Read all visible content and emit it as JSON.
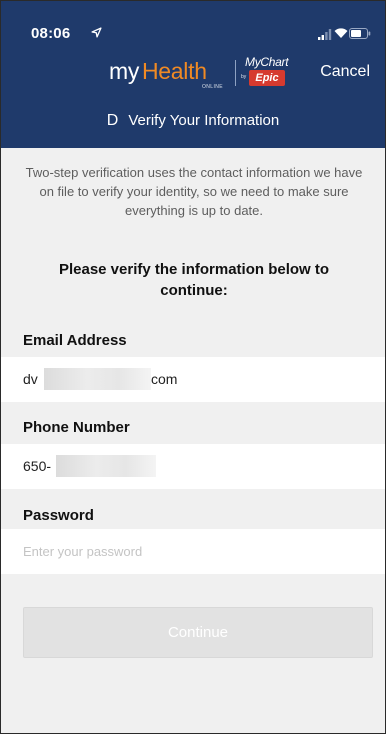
{
  "status_bar": {
    "time": "08:06"
  },
  "brand": {
    "my": "my",
    "health": "Health",
    "online": "ONLINE",
    "mychart": "MyChart",
    "by": "by",
    "epic": "Epic"
  },
  "header": {
    "cancel_label": "Cancel",
    "title_letter": "D",
    "title": "Verify Your Information"
  },
  "intro_text": "Two-step verification uses the contact information we have on file to verify your identity, so we need to make sure everything is up to date.",
  "instruction": "Please verify the information below to continue:",
  "form": {
    "email": {
      "label": "Email Address",
      "value_prefix": "dv",
      "value_suffix": "com"
    },
    "phone": {
      "label": "Phone Number",
      "value_prefix": "650-"
    },
    "password": {
      "label": "Password",
      "placeholder": "Enter your password"
    }
  },
  "continue_label": "Continue",
  "colors": {
    "header": "#1f3a6b",
    "brand_orange": "#f08a24",
    "epic_red": "#d63a2f",
    "background": "#f0f0f0",
    "button_disabled": "#e2e2e2"
  },
  "icons": [
    "location-arrow-icon",
    "signal-icon",
    "wifi-icon",
    "battery-icon"
  ]
}
